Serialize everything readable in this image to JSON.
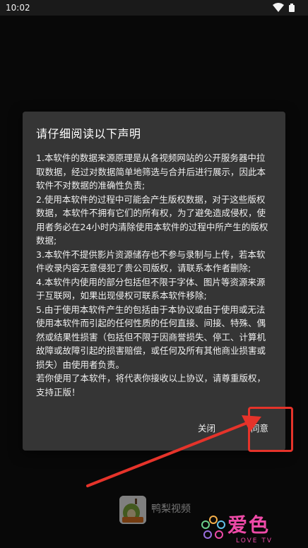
{
  "status_bar": {
    "time": "10:02",
    "icons": [
      "wifi-icon",
      "battery-icon"
    ]
  },
  "dialog": {
    "title": "请仔细阅读以下声明",
    "paragraphs": [
      "1.本软件的数据来源原理是从各视频网站的公开服务器中拉取数据，经过对数据简单地筛选与合并后进行展示，因此本软件不对数据的准确性负责;",
      "2.使用本软件的过程中可能会产生版权数据，对于这些版权数据，本软件不拥有它们的所有权，为了避免造成侵权，使用者务必在24小时内清除使用本软件的过程中所产生的版权数据;",
      "3.本软件不提供影片资源储存也不参与录制与上传，若本软件收录内容无意侵犯了贵公司版权，请联系本作者删除;",
      "4.本软件内使用的部分包括但不限于字体、图片等资源来源于互联网，如果出现侵权可联系本软件移除;",
      "5.由于使用本软件产生的包括由于本协议或由于使用或无法使用本软件而引起的任何性质的任何直接、间接、特殊、偶然或结果性损害（包括但不限于因商誉损失、停工、计算机故障或故障引起的损害赔偿，或任何及所有其他商业损害或损失）由使用者负责。",
      "若你使用了本软件，将代表你接收以上协议，请尊重版权，支持正版！"
    ],
    "buttons": {
      "close": "关闭",
      "agree": "同意"
    }
  },
  "app": {
    "logo_text": "鸭梨",
    "name": "鸭梨视频"
  },
  "watermark": {
    "text": "爱色",
    "sub": "LOVE TV"
  },
  "colors": {
    "annotation": "#e5332a",
    "dialog_bg": "#353535",
    "watermark": "#ee4aa7"
  }
}
